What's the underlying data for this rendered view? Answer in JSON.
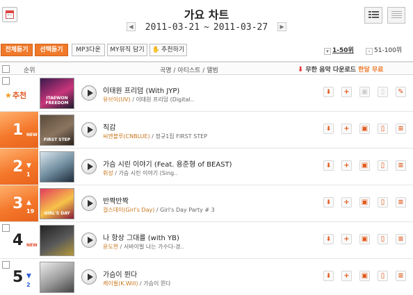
{
  "header": {
    "title": "가요 차트",
    "date_start": "2011-03-21",
    "date_sep": "~",
    "date_end": "2011-03-27",
    "prev_symbol": "◀",
    "next_symbol": "▶",
    "calendar_icon": "calendar-icon",
    "view_list_icon": "list-view-icon",
    "view_grid_icon": "compact-view-icon"
  },
  "toolbar": {
    "select_all": "전체듣기",
    "selected_play": "선택듣기",
    "mp3_download": "MP3다운",
    "my_music": "MY뮤직 담기",
    "recommend": "추천하기",
    "recommend_icon": "thumb-up-icon",
    "range_current": "1-50위",
    "range_next": "51-100위"
  },
  "columns": {
    "rank": "순위",
    "song": "곡명 / 아티스트 / 앨범",
    "promo_prefix": "무한 음악 다운로드",
    "promo_highlight": "한달 무료"
  },
  "colors": {
    "accent": "#f07a2a",
    "artist": "#c8761a",
    "up": "#e33b2a",
    "down": "#2a5bd7"
  },
  "rows": [
    {
      "featured": true,
      "rank_label": "추천",
      "title": "이태원 프리덤 (With JYP)",
      "artist": "유브이(UV)",
      "album": " / 이태원 프리덤 (Digital..",
      "cover_text": "ITAEWON FREEDOM",
      "cover_colors": [
        "#3a1a4e",
        "#c9357a",
        "#1c1c2e"
      ]
    },
    {
      "rank": "1",
      "change": "NEW",
      "title": "직감",
      "artist": "씨엔블루(CNBLUE)",
      "album": " / 정규1집 FIRST STEP",
      "cover_text": "FIRST STEP",
      "cover_colors": [
        "#5a4a3a",
        "#8b7560",
        "#2a221c"
      ]
    },
    {
      "rank": "2",
      "change_dir": "down",
      "change": "1",
      "title": "가슴 시린 이야기 (Feat. 용준형 of BEAST)",
      "artist": "휘성",
      "album": " / 가슴 시린 이야기 (Sing..",
      "cover_text": "",
      "cover_colors": [
        "#d9e6ee",
        "#6d8a9c",
        "#1f2b3a"
      ]
    },
    {
      "rank": "3",
      "change_dir": "up",
      "change": "19",
      "title": "반짝반짝",
      "artist": "걸스데이(Girl's Day)",
      "album": " / Girl's Day Party # 3",
      "cover_text": "GIRL'S DAY",
      "cover_colors": [
        "#e23b5c",
        "#f7c34a",
        "#8a1a3a"
      ]
    },
    {
      "rank": "4",
      "change": "NEW",
      "title": "나 항상 그대를 (with YB)",
      "artist": "윤도현",
      "album": " / 서바이벌 나는 가수다-경..",
      "cover_text": "",
      "cover_colors": [
        "#222",
        "#5a5a5a",
        "#b69a3a"
      ]
    },
    {
      "rank": "5",
      "change_dir": "down",
      "change": "2",
      "title": "가슴이 뛴다",
      "artist": "케이윌(K.Will)",
      "album": " / 가슴이 뛴다",
      "cover_text": "",
      "cover_colors": [
        "#ececec",
        "#9a9a9a",
        "#444"
      ]
    }
  ]
}
